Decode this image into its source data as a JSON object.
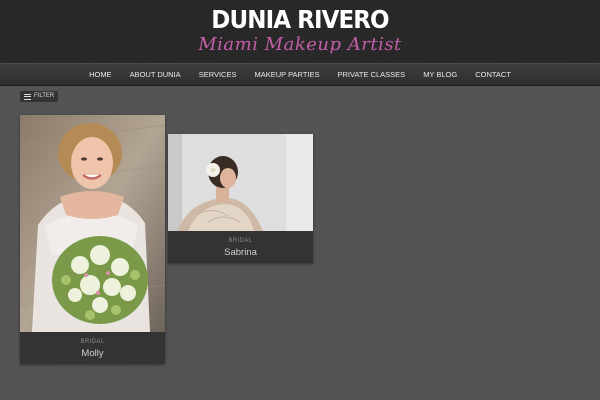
{
  "header": {
    "title": "DUNIA RIVERO",
    "tagline": "Miami Makeup Artist"
  },
  "nav": {
    "items": [
      "HOME",
      "ABOUT DUNIA",
      "SERVICES",
      "MAKEUP PARTIES",
      "PRIVATE CLASSES",
      "MY BLOG",
      "CONTACT"
    ]
  },
  "filter": {
    "label": "FILTER",
    "icon": "menu-lines-icon"
  },
  "portfolio": {
    "items": [
      {
        "category": "BRIDAL",
        "name": "Molly"
      },
      {
        "category": "BRIDAL",
        "name": "Sabrina"
      }
    ]
  },
  "colors": {
    "accent": "#c45ea8",
    "background": "#555555",
    "header": "#262626",
    "card": "#333333"
  }
}
